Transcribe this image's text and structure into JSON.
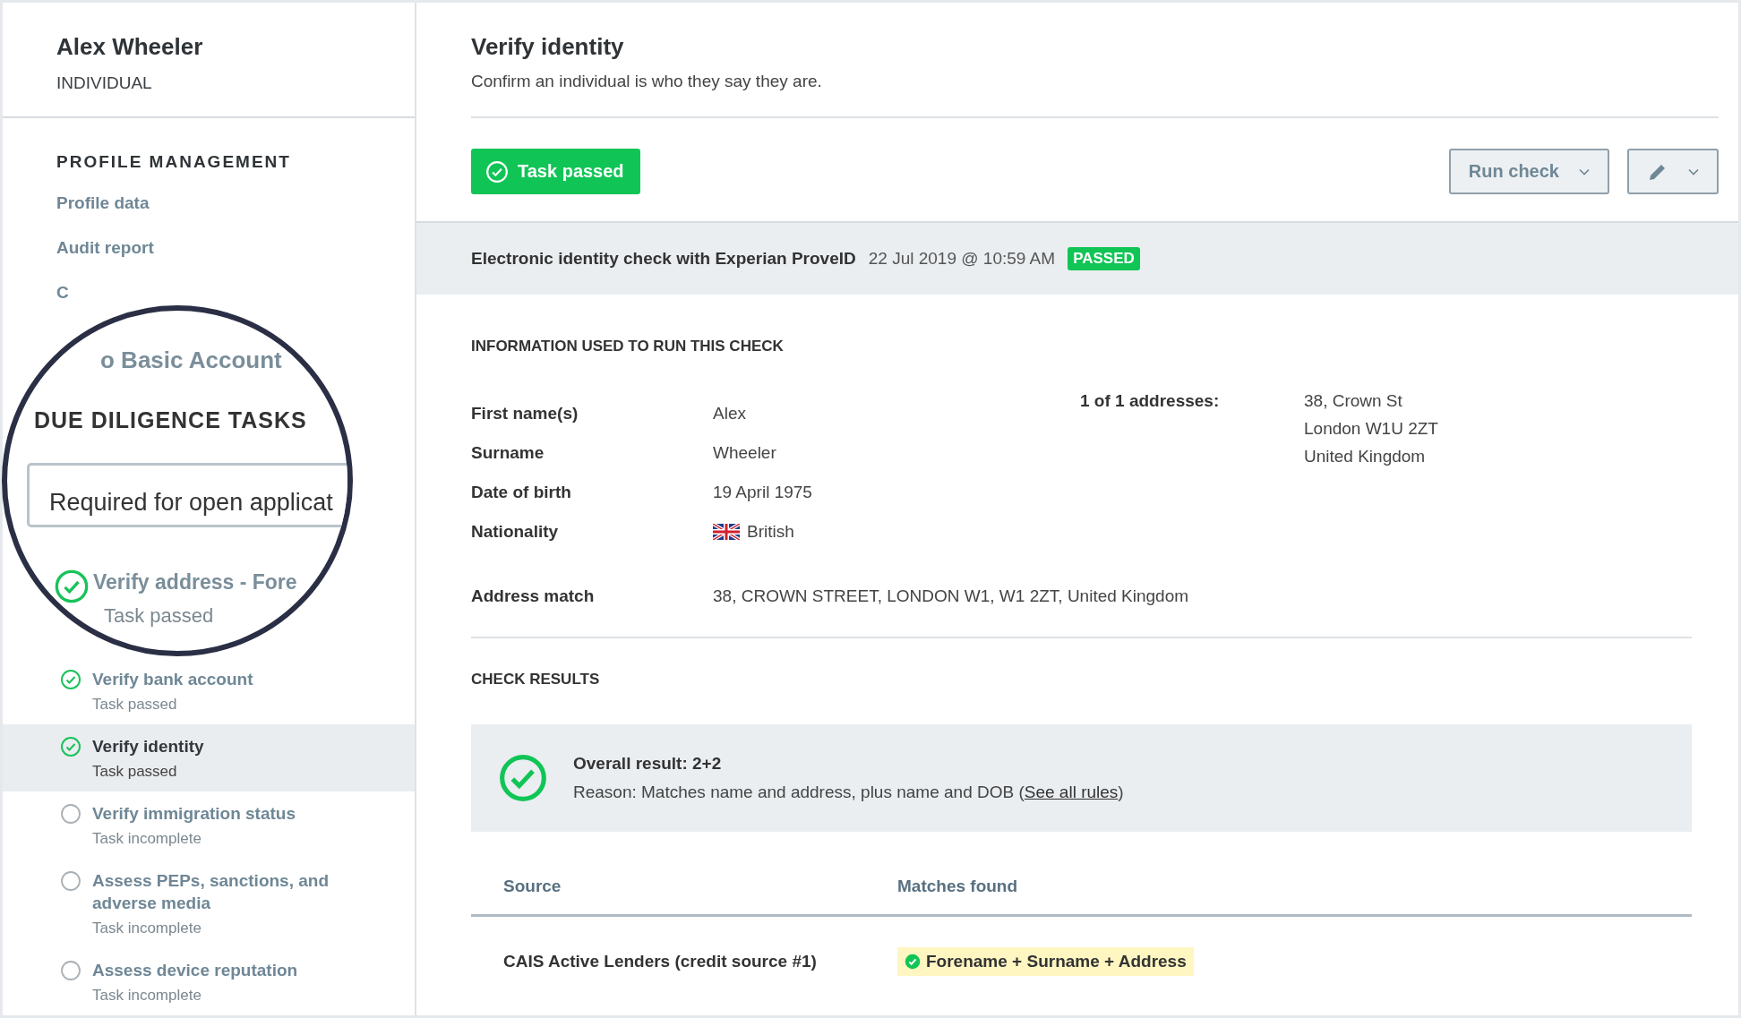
{
  "sidebar": {
    "name": "Alex Wheeler",
    "type": "INDIVIDUAL",
    "section_title": "PROFILE MANAGEMENT",
    "links": [
      "Profile data",
      "Audit report",
      "C"
    ],
    "tasks": [
      {
        "name": "Verify bank account",
        "status": "Task passed",
        "passed": true,
        "selected": false
      },
      {
        "name": "Verify identity",
        "status": "Task passed",
        "passed": true,
        "selected": true
      },
      {
        "name": "Verify immigration status",
        "status": "Task incomplete",
        "passed": false,
        "selected": false
      },
      {
        "name": "Assess PEPs, sanctions, and adverse media",
        "status": "Task incomplete",
        "passed": false,
        "selected": false
      },
      {
        "name": "Assess device reputation",
        "status": "Task incomplete",
        "passed": false,
        "selected": false
      }
    ]
  },
  "magnifier": {
    "link": "o Basic Account",
    "heading": "DUE DILIGENCE TASKS",
    "filter": {
      "value": "Required for open applicat"
    },
    "task": {
      "name": "Verify address - Fore",
      "status": "Task passed",
      "passed": true
    }
  },
  "main": {
    "title": "Verify identity",
    "subtitle": "Confirm an individual is who they say they are.",
    "status_button": "Task passed",
    "run_button": "Run check",
    "check": {
      "name": "Electronic identity check with Experian ProveID",
      "date": "22 Jul 2019 @ 10:59 AM",
      "badge": "PASSED"
    },
    "info_heading": "INFORMATION USED TO RUN THIS CHECK",
    "fields": [
      {
        "label": "First name(s)",
        "value": "Alex"
      },
      {
        "label": "Surname",
        "value": "Wheeler"
      },
      {
        "label": "Date of birth",
        "value": "19 April 1975"
      },
      {
        "label": "Nationality",
        "value": "British",
        "kind": "flag"
      }
    ],
    "addresses_label": "1 of 1 addresses:",
    "address_lines": [
      "38, Crown St",
      "London W1U 2ZT",
      "United Kingdom"
    ],
    "address_match": {
      "label": "Address match",
      "value": "38, CROWN STREET, LONDON W1, W1 2ZT, United Kingdom"
    },
    "results_heading": "CHECK RESULTS",
    "result": {
      "title": "Overall result: 2+2",
      "reason": "Reason: Matches name and address, plus name and DOB (",
      "link": "See all rules",
      "after": ")"
    },
    "table": {
      "columns": [
        "Source",
        "Matches found"
      ],
      "rows": [
        {
          "source": "CAIS Active Lenders (credit source #1)",
          "match": "Forename + Surname + Address"
        }
      ]
    }
  }
}
